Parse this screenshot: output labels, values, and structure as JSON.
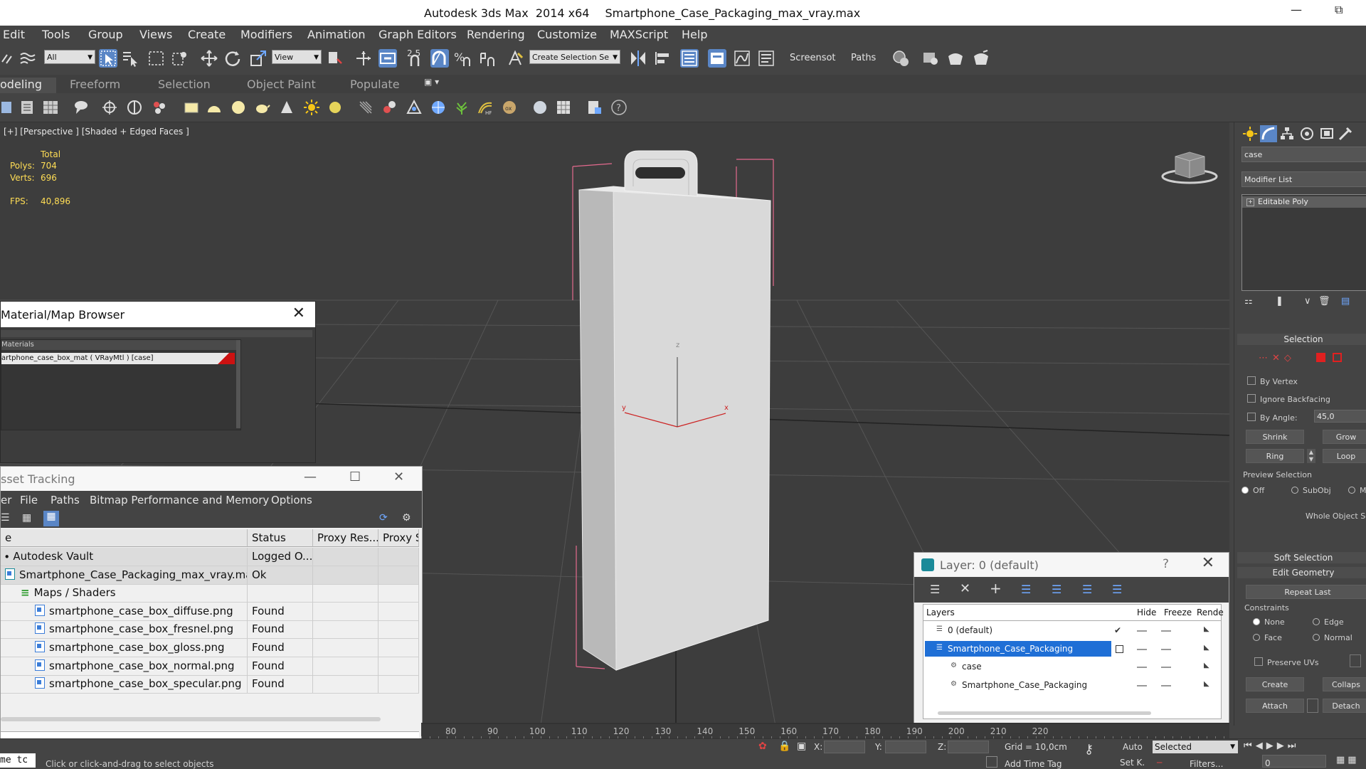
{
  "window": {
    "app_title": "Autodesk 3ds Max  2014 x64",
    "file_name": "Smartphone_Case_Packaging_max_vray.max"
  },
  "menu": [
    "Edit",
    "Tools",
    "Group",
    "Views",
    "Create",
    "Modifiers",
    "Animation",
    "Graph Editors",
    "Rendering",
    "Customize",
    "MAXScript",
    "Help"
  ],
  "toolbar": {
    "filter_value": "All",
    "ref_coord_value": "View",
    "snap_label": "2.5",
    "named_selection_placeholder": "Create Selection Se",
    "screensot_label": "Screensot",
    "paths_label": "Paths"
  },
  "ribbon_tabs": [
    "odeling",
    "Freeform",
    "Selection",
    "Object Paint",
    "Populate"
  ],
  "viewport": {
    "label": "[+] [Perspective ] [Shaded + Edged Faces ]",
    "stats_total_label": "Total",
    "polys_label": "Polys:",
    "polys_value": "704",
    "verts_label": "Verts:",
    "verts_value": "696",
    "fps_label": "FPS:",
    "fps_value": "40,896",
    "axis_z": "z",
    "axis_y": "y",
    "axis_x": "x"
  },
  "material_browser": {
    "title": "Material/Map Browser",
    "section": "Materials",
    "row": "artphone_case_box_mat ( VRayMtl ) [case]"
  },
  "asset_tracking": {
    "title": "sset Tracking",
    "menu": [
      "er",
      "File",
      "Paths",
      "Bitmap Performance and Memory",
      "Options"
    ],
    "columns": [
      "e",
      "Status",
      "Proxy Res...",
      "Proxy S"
    ],
    "rows": [
      {
        "name": "Autodesk Vault",
        "status": "Logged O...",
        "indent": 0,
        "kind": "vault"
      },
      {
        "name": "Smartphone_Case_Packaging_max_vray.max",
        "status": "Ok",
        "indent": 1,
        "kind": "max"
      },
      {
        "name": "Maps / Shaders",
        "status": "",
        "indent": 2,
        "kind": "folder"
      },
      {
        "name": "smartphone_case_box_diffuse.png",
        "status": "Found",
        "indent": 3,
        "kind": "file"
      },
      {
        "name": "smartphone_case_box_fresnel.png",
        "status": "Found",
        "indent": 3,
        "kind": "file"
      },
      {
        "name": "smartphone_case_box_gloss.png",
        "status": "Found",
        "indent": 3,
        "kind": "file"
      },
      {
        "name": "smartphone_case_box_normal.png",
        "status": "Found",
        "indent": 3,
        "kind": "file"
      },
      {
        "name": "smartphone_case_box_specular.png",
        "status": "Found",
        "indent": 3,
        "kind": "file"
      }
    ]
  },
  "layer_dialog": {
    "title": "Layer: 0 (default)",
    "help": "?",
    "columns": [
      "Layers",
      "Hide",
      "Freeze",
      "Rende"
    ],
    "rows": [
      {
        "name": "0 (default)",
        "selected": false
      },
      {
        "name": "Smartphone_Case_Packaging",
        "selected": true
      },
      {
        "name": "case",
        "selected": false
      },
      {
        "name": "Smartphone_Case_Packaging",
        "selected": false
      }
    ]
  },
  "command_panel": {
    "object_name": "case",
    "modifier_list": "Modifier List",
    "stack_item": "Editable Poly",
    "selection_title": "Selection",
    "by_vertex": "By Vertex",
    "ignore_backfacing": "Ignore Backfacing",
    "by_angle": "By Angle:",
    "angle_value": "45,0",
    "shrink": "Shrink",
    "grow": "Grow",
    "ring": "Ring",
    "loop": "Loop",
    "preview_selection": "Preview Selection",
    "off": "Off",
    "subobj": "SubObj",
    "multi": "M",
    "whole_object": "Whole Object Se",
    "soft_selection": "Soft Selection",
    "edit_geometry": "Edit Geometry",
    "repeat_last": "Repeat Last",
    "constraints": "Constraints",
    "none": "None",
    "edge": "Edge",
    "face": "Face",
    "normal": "Normal",
    "preserve_uvs": "Preserve UVs",
    "create": "Create",
    "collapse": "Collaps",
    "attach": "Attach",
    "detach": "Detach"
  },
  "timeline_ticks": [
    "80",
    "90",
    "100",
    "110",
    "120",
    "130",
    "140",
    "150",
    "160",
    "170",
    "180",
    "190",
    "200",
    "210",
    "220"
  ],
  "status_bar": {
    "script_box": "me tc",
    "prompt": "Click or click-and-drag to select objects",
    "x_label": "X:",
    "y_label": "Y:",
    "z_label": "Z:",
    "grid": "Grid = 10,0cm",
    "add_time_tag": "Add Time Tag",
    "auto": "Auto",
    "set_key": "Set K.",
    "selected": "Selected",
    "filters": "Filters...",
    "frame": "0"
  }
}
